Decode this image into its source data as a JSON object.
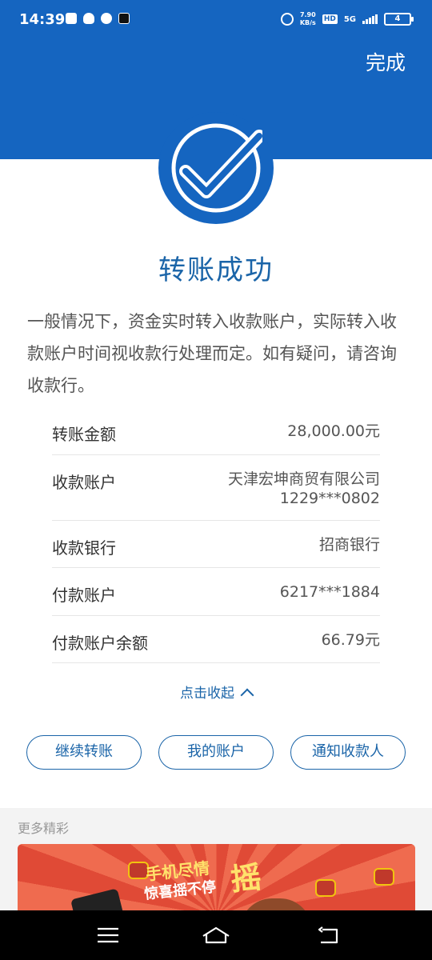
{
  "status_bar": {
    "time": "14:39",
    "speed_value": "7.90",
    "speed_unit": "KB/s",
    "hd": "HD",
    "network": "5G",
    "battery": "4"
  },
  "header": {
    "done_label": "完成",
    "background_color": "#1565c0"
  },
  "result": {
    "title": "转账成功",
    "description": "一般情况下，资金实时转入收款账户，实际转入收款账户时间视收款行处理而定。如有疑问，请咨询收款行。"
  },
  "details": [
    {
      "label": "转账金额",
      "value": "28,000.00元"
    },
    {
      "label": "收款账户",
      "value": "天津宏坤商贸有限公司",
      "value2": "1229***0802"
    },
    {
      "label": "收款银行",
      "value": "招商银行"
    },
    {
      "label": "付款账户",
      "value": "6217***1884"
    },
    {
      "label": "付款账户余额",
      "value": "66.79元"
    }
  ],
  "collapse_label": "点击收起",
  "actions": {
    "continue_transfer": "继续转账",
    "my_account": "我的账户",
    "notify_payee": "通知收款人"
  },
  "more": {
    "title": "更多精彩",
    "banner_line1": "手机尽情",
    "banner_line2": "惊喜摇不停",
    "banner_big": "摇"
  },
  "icons": {
    "success": "checkmark-circle-icon",
    "collapse": "chevron-up-icon",
    "nav_menu": "menu-icon",
    "nav_home": "home-icon",
    "nav_back": "back-icon"
  }
}
